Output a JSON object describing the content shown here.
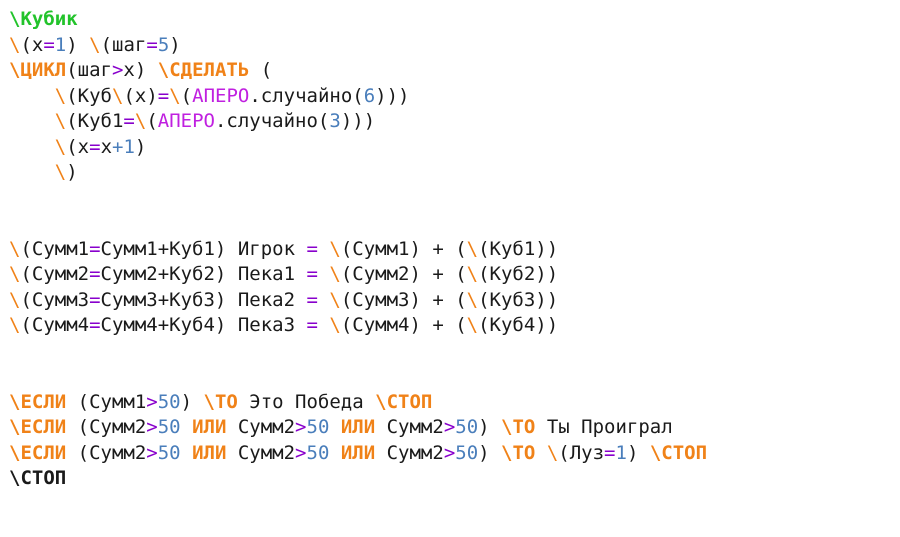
{
  "editor": {
    "language": "AlgoBox (Russian)",
    "background": "#ffffff",
    "font_size_px": 19,
    "line_height_px": 25.5
  },
  "palette": {
    "procedure_green": "#22c32b",
    "keyword_orange": "#f08218",
    "library_magenta": "#c020e0",
    "operator_violet": "#8800cc",
    "number_blue": "#4a7ebb",
    "text_black": "#1a1a1a"
  },
  "code": {
    "lines": [
      {
        "id": "line-1",
        "tokens": [
          {
            "t": "\\Кубик",
            "c": "proc"
          }
        ]
      },
      {
        "id": "line-2",
        "tokens": [
          {
            "t": "\\",
            "c": "slash"
          },
          {
            "t": "(x",
            "c": "plain"
          },
          {
            "t": "=",
            "c": "op"
          },
          {
            "t": "1",
            "c": "num"
          },
          {
            "t": ") ",
            "c": "plain"
          },
          {
            "t": "\\",
            "c": "slash"
          },
          {
            "t": "(шаг",
            "c": "plain"
          },
          {
            "t": "=",
            "c": "op"
          },
          {
            "t": "5",
            "c": "num"
          },
          {
            "t": ")",
            "c": "plain"
          }
        ]
      },
      {
        "id": "line-3",
        "tokens": [
          {
            "t": "\\ЦИКЛ",
            "c": "kw"
          },
          {
            "t": "(шаг",
            "c": "plain"
          },
          {
            "t": ">",
            "c": "op"
          },
          {
            "t": "x) ",
            "c": "plain"
          },
          {
            "t": "\\СДЕЛАТЬ",
            "c": "kw"
          },
          {
            "t": " (",
            "c": "plain"
          }
        ]
      },
      {
        "id": "line-4",
        "tokens": [
          {
            "t": "    ",
            "c": "plain"
          },
          {
            "t": "\\",
            "c": "slash"
          },
          {
            "t": "(Куб",
            "c": "plain"
          },
          {
            "t": "\\",
            "c": "slash"
          },
          {
            "t": "(x)",
            "c": "plain"
          },
          {
            "t": "=",
            "c": "op"
          },
          {
            "t": "\\",
            "c": "slash"
          },
          {
            "t": "(",
            "c": "plain"
          },
          {
            "t": "АПЕРО",
            "c": "lib"
          },
          {
            "t": ".случайно(",
            "c": "plain"
          },
          {
            "t": "6",
            "c": "num"
          },
          {
            "t": ")))",
            "c": "plain"
          }
        ]
      },
      {
        "id": "line-5",
        "tokens": [
          {
            "t": "    ",
            "c": "plain"
          },
          {
            "t": "\\",
            "c": "slash"
          },
          {
            "t": "(Куб1",
            "c": "plain"
          },
          {
            "t": "=",
            "c": "op"
          },
          {
            "t": "\\",
            "c": "slash"
          },
          {
            "t": "(",
            "c": "plain"
          },
          {
            "t": "АПЕРО",
            "c": "lib"
          },
          {
            "t": ".случайно(",
            "c": "plain"
          },
          {
            "t": "3",
            "c": "num"
          },
          {
            "t": ")))",
            "c": "plain"
          }
        ]
      },
      {
        "id": "line-6",
        "tokens": [
          {
            "t": "    ",
            "c": "plain"
          },
          {
            "t": "\\",
            "c": "slash"
          },
          {
            "t": "(x",
            "c": "plain"
          },
          {
            "t": "=",
            "c": "op"
          },
          {
            "t": "x",
            "c": "plain"
          },
          {
            "t": "+1",
            "c": "num"
          },
          {
            "t": ")",
            "c": "plain"
          }
        ]
      },
      {
        "id": "line-7",
        "tokens": [
          {
            "t": "    ",
            "c": "plain"
          },
          {
            "t": "\\",
            "c": "slash"
          },
          {
            "t": ")",
            "c": "plain"
          }
        ]
      },
      {
        "id": "line-8",
        "blank": true,
        "tokens": []
      },
      {
        "id": "line-9",
        "blank": true,
        "tokens": []
      },
      {
        "id": "line-10",
        "tokens": [
          {
            "t": "\\",
            "c": "slash"
          },
          {
            "t": "(Сумм1",
            "c": "plain"
          },
          {
            "t": "=",
            "c": "op"
          },
          {
            "t": "Сумм1+Куб1) Игрок ",
            "c": "plain"
          },
          {
            "t": "=",
            "c": "op"
          },
          {
            "t": " ",
            "c": "plain"
          },
          {
            "t": "\\",
            "c": "slash"
          },
          {
            "t": "(Сумм1) + (",
            "c": "plain"
          },
          {
            "t": "\\",
            "c": "slash"
          },
          {
            "t": "(Куб1))",
            "c": "plain"
          }
        ]
      },
      {
        "id": "line-11",
        "tokens": [
          {
            "t": "\\",
            "c": "slash"
          },
          {
            "t": "(Сумм2",
            "c": "plain"
          },
          {
            "t": "=",
            "c": "op"
          },
          {
            "t": "Сумм2+Куб2) Пека1 ",
            "c": "plain"
          },
          {
            "t": "=",
            "c": "op"
          },
          {
            "t": " ",
            "c": "plain"
          },
          {
            "t": "\\",
            "c": "slash"
          },
          {
            "t": "(Сумм2) + (",
            "c": "plain"
          },
          {
            "t": "\\",
            "c": "slash"
          },
          {
            "t": "(Куб2))",
            "c": "plain"
          }
        ]
      },
      {
        "id": "line-12",
        "tokens": [
          {
            "t": "\\",
            "c": "slash"
          },
          {
            "t": "(Сумм3",
            "c": "plain"
          },
          {
            "t": "=",
            "c": "op"
          },
          {
            "t": "Сумм3+Куб3) Пека2 ",
            "c": "plain"
          },
          {
            "t": "=",
            "c": "op"
          },
          {
            "t": " ",
            "c": "plain"
          },
          {
            "t": "\\",
            "c": "slash"
          },
          {
            "t": "(Сумм3) + (",
            "c": "plain"
          },
          {
            "t": "\\",
            "c": "slash"
          },
          {
            "t": "(Куб3))",
            "c": "plain"
          }
        ]
      },
      {
        "id": "line-13",
        "tokens": [
          {
            "t": "\\",
            "c": "slash"
          },
          {
            "t": "(Сумм4",
            "c": "plain"
          },
          {
            "t": "=",
            "c": "op"
          },
          {
            "t": "Сумм4+Куб4) Пека3 ",
            "c": "plain"
          },
          {
            "t": "=",
            "c": "op"
          },
          {
            "t": " ",
            "c": "plain"
          },
          {
            "t": "\\",
            "c": "slash"
          },
          {
            "t": "(Сумм4) + (",
            "c": "plain"
          },
          {
            "t": "\\",
            "c": "slash"
          },
          {
            "t": "(Куб4))",
            "c": "plain"
          }
        ]
      },
      {
        "id": "line-14",
        "blank": true,
        "tokens": []
      },
      {
        "id": "line-15",
        "blank": true,
        "tokens": []
      },
      {
        "id": "line-16",
        "tokens": [
          {
            "t": "\\ЕСЛИ",
            "c": "kw"
          },
          {
            "t": " (Сумм1",
            "c": "plain"
          },
          {
            "t": ">",
            "c": "op"
          },
          {
            "t": "50",
            "c": "num"
          },
          {
            "t": ") ",
            "c": "plain"
          },
          {
            "t": "\\ТО",
            "c": "kw"
          },
          {
            "t": " Это Победа ",
            "c": "plain"
          },
          {
            "t": "\\СТОП",
            "c": "kw"
          }
        ]
      },
      {
        "id": "line-17",
        "tokens": [
          {
            "t": "\\ЕСЛИ",
            "c": "kw"
          },
          {
            "t": " (Сумм2",
            "c": "plain"
          },
          {
            "t": ">",
            "c": "op"
          },
          {
            "t": "50",
            "c": "num"
          },
          {
            "t": " ",
            "c": "plain"
          },
          {
            "t": "ИЛИ",
            "c": "kw"
          },
          {
            "t": " Сумм2",
            "c": "plain"
          },
          {
            "t": ">",
            "c": "op"
          },
          {
            "t": "50",
            "c": "num"
          },
          {
            "t": " ",
            "c": "plain"
          },
          {
            "t": "ИЛИ",
            "c": "kw"
          },
          {
            "t": " Сумм2",
            "c": "plain"
          },
          {
            "t": ">",
            "c": "op"
          },
          {
            "t": "50",
            "c": "num"
          },
          {
            "t": ") ",
            "c": "plain"
          },
          {
            "t": "\\ТО",
            "c": "kw"
          },
          {
            "t": " Ты Проиграл",
            "c": "plain"
          }
        ]
      },
      {
        "id": "line-18",
        "tokens": [
          {
            "t": "\\ЕСЛИ",
            "c": "kw"
          },
          {
            "t": " (Сумм2",
            "c": "plain"
          },
          {
            "t": ">",
            "c": "op"
          },
          {
            "t": "50",
            "c": "num"
          },
          {
            "t": " ",
            "c": "plain"
          },
          {
            "t": "ИЛИ",
            "c": "kw"
          },
          {
            "t": " Сумм2",
            "c": "plain"
          },
          {
            "t": ">",
            "c": "op"
          },
          {
            "t": "50",
            "c": "num"
          },
          {
            "t": " ",
            "c": "plain"
          },
          {
            "t": "ИЛИ",
            "c": "kw"
          },
          {
            "t": " Сумм2",
            "c": "plain"
          },
          {
            "t": ">",
            "c": "op"
          },
          {
            "t": "50",
            "c": "num"
          },
          {
            "t": ") ",
            "c": "plain"
          },
          {
            "t": "\\ТО",
            "c": "kw"
          },
          {
            "t": " ",
            "c": "plain"
          },
          {
            "t": "\\",
            "c": "slash"
          },
          {
            "t": "(Луз",
            "c": "plain"
          },
          {
            "t": "=",
            "c": "op"
          },
          {
            "t": "1",
            "c": "num"
          },
          {
            "t": ") ",
            "c": "plain"
          },
          {
            "t": "\\СТОП",
            "c": "kw"
          }
        ]
      },
      {
        "id": "line-19",
        "tokens": [
          {
            "t": "\\СТОП",
            "c": "stopblk"
          }
        ]
      }
    ]
  }
}
